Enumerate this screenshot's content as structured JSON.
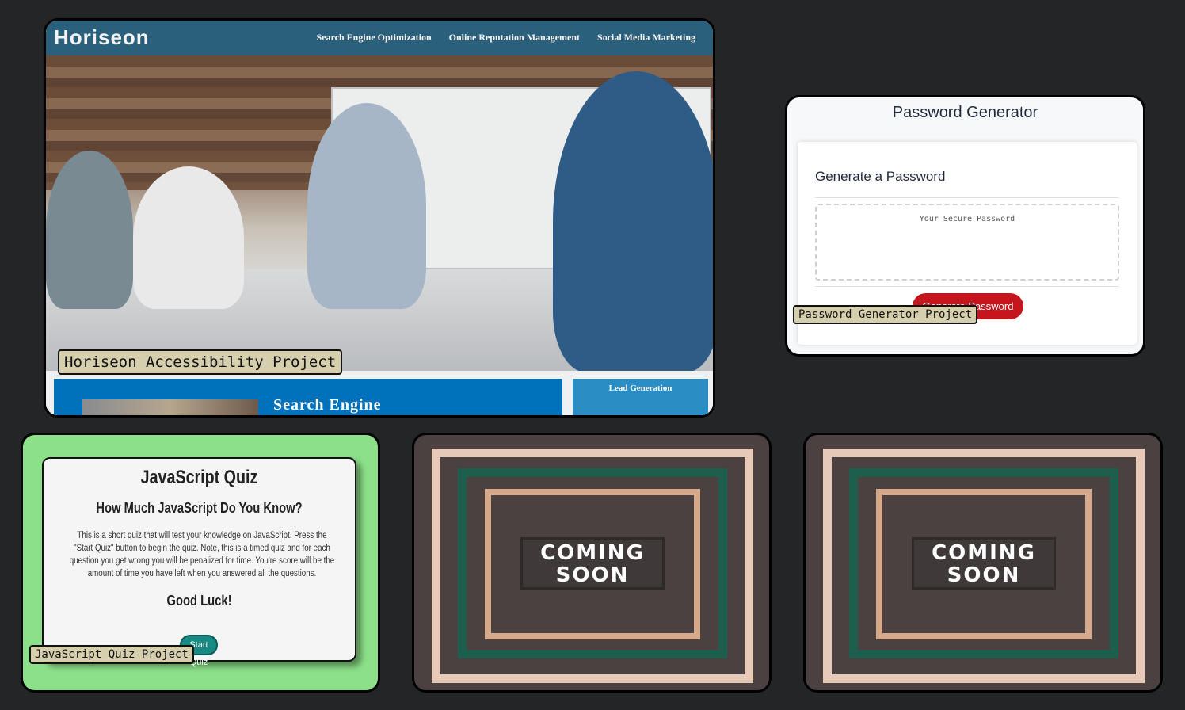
{
  "horiseon": {
    "logo": "Horiseon",
    "nav": [
      "Search Engine Optimization",
      "Online Reputation Management",
      "Social Media Marketing"
    ],
    "section_title": "Search Engine",
    "side_title": "Lead Generation",
    "caption": "Horiseon Accessibility Project"
  },
  "password": {
    "title": "Password Generator",
    "heading": "Generate a Password",
    "placeholder": "Your Secure Password",
    "button_label": "Generate Password",
    "caption": "Password Generator Project"
  },
  "quiz": {
    "title": "JavaScript Quiz",
    "subtitle": "How Much JavaScript Do You Know?",
    "body": "This is a short quiz that will test your knowledge on JavaScript. Press the \"Start Quiz\" button to begin the quiz. Note, this is a timed quiz and for each question you get wrong you will be penalized for time. You're score will be the amount of time you have left when you answered all the questions.",
    "luck": "Good Luck!",
    "button_label": "Start Quiz",
    "caption": "JavaScript Quiz Project"
  },
  "coming_soon": [
    {
      "line1": "COMING",
      "line2": "SOON"
    },
    {
      "line1": "COMING",
      "line2": "SOON"
    }
  ],
  "colors": {
    "background": "#242526",
    "caption_bg": "#d6cfae",
    "horiseon_header": "#2a607c",
    "password_button": "#c4161c",
    "quiz_bg": "#8ce08a",
    "soon_frame_outer": "#e6c9b6",
    "soon_frame_mid": "#1d5e4c",
    "soon_frame_inner": "#d6a98a"
  }
}
